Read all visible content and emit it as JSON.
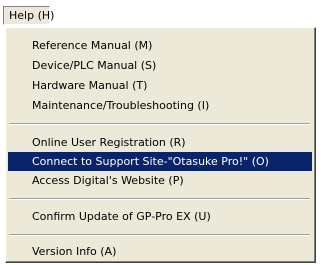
{
  "menubar": {
    "label": "Help (H)"
  },
  "menu": {
    "items": [
      {
        "label": "Reference Manual (M)"
      },
      {
        "label": "Device/PLC Manual (S)"
      },
      {
        "label": "Hardware Manual (T)"
      },
      {
        "label": "Maintenance/Troubleshooting (I)"
      },
      {
        "label": "Online User Registration (R)"
      },
      {
        "label": "Connect to Support Site-\"Otasuke Pro!\" (O)"
      },
      {
        "label": "Access Digital's Website (P)"
      },
      {
        "label": "Confirm Update of GP-Pro EX (U)"
      },
      {
        "label": "Version Info (A)"
      }
    ],
    "highlight_color": "#0a246a"
  }
}
